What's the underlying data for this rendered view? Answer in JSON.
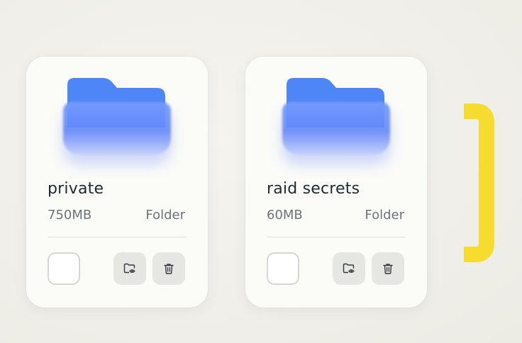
{
  "files": [
    {
      "name": "private",
      "size": "750MB",
      "type": "Folder",
      "selected": false
    },
    {
      "name": "raid secrets",
      "size": "60MB",
      "type": "Folder",
      "selected": false
    }
  ],
  "icons": {
    "folder": "folder-icon",
    "view": "folder-eye-icon",
    "delete": "trash-icon"
  },
  "colors": {
    "folder_blue": "#4f86f7",
    "accent_yellow": "#f6dc2f",
    "card_bg": "#fbfbf8"
  }
}
